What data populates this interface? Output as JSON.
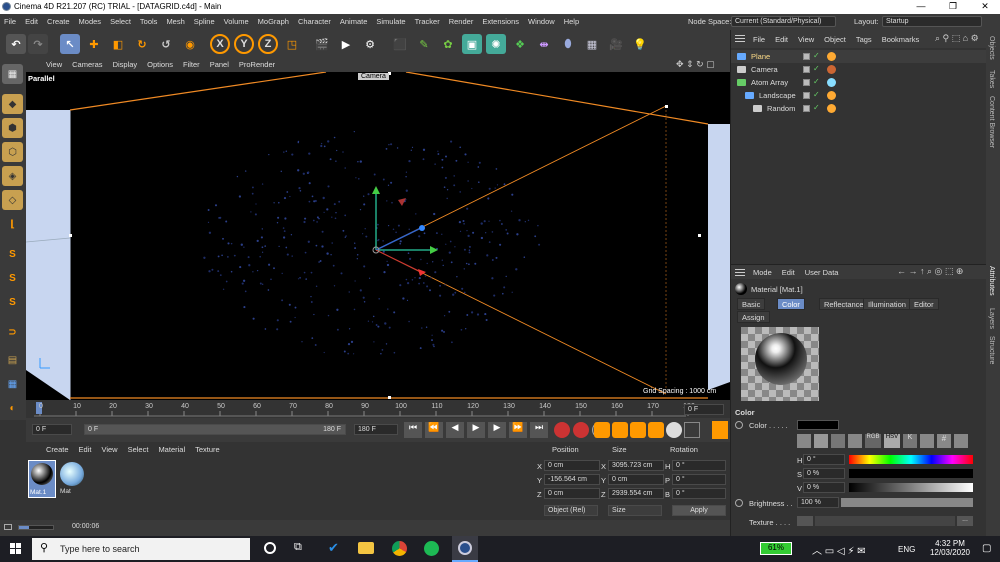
{
  "window": {
    "title": "Cinema 4D R21.207 (RC) TRIAL - [DATAGRID.c4d] - Main",
    "minimize": "—",
    "restore": "❐",
    "close": "✕"
  },
  "menu": [
    "File",
    "Edit",
    "Create",
    "Modes",
    "Select",
    "Tools",
    "Mesh",
    "Spline",
    "Volume",
    "MoGraph",
    "Character",
    "Animate",
    "Simulate",
    "Tracker",
    "Render",
    "Extensions",
    "Window",
    "Help"
  ],
  "nodespace": {
    "label": "Node Space:",
    "value": "Current (Standard/Physical)"
  },
  "layout": {
    "label": "Layout:",
    "value": "Startup"
  },
  "toolbar": {
    "axis_x": "X",
    "axis_y": "Y",
    "axis_z": "Z"
  },
  "viewport": {
    "menu": [
      "View",
      "Cameras",
      "Display",
      "Options",
      "Filter",
      "Panel",
      "ProRender"
    ],
    "projection": "Parallel",
    "camera_label": "Camera",
    "grid_spacing": "Grid Spacing : 1000 cm"
  },
  "timeline": {
    "ticks": [
      "0",
      "10",
      "20",
      "30",
      "40",
      "50",
      "60",
      "70",
      "80",
      "90",
      "100",
      "110",
      "120",
      "130",
      "140",
      "150",
      "160",
      "170",
      "180"
    ],
    "current_frame_field": "0 F",
    "start_field": "0 F",
    "range_start": "0 F",
    "range_end": "180 F",
    "end_field": "180 F"
  },
  "material_manager": {
    "menu": [
      "Create",
      "Edit",
      "View",
      "Select",
      "Material",
      "Texture"
    ],
    "materials": [
      {
        "name": "Mat.1",
        "type": "chrome"
      },
      {
        "name": "Mat",
        "type": "glow"
      }
    ]
  },
  "coords": {
    "headers": {
      "position": "Position",
      "size": "Size",
      "rotation": "Rotation"
    },
    "rows": [
      {
        "axis": "X",
        "pos": "0 cm",
        "size_axis": "X",
        "size": "3095.723 cm",
        "rot_axis": "H",
        "rot": "0 °"
      },
      {
        "axis": "Y",
        "pos": "-156.564 cm",
        "size_axis": "Y",
        "size": "0 cm",
        "rot_axis": "P",
        "rot": "0 °"
      },
      {
        "axis": "Z",
        "pos": "0 cm",
        "size_axis": "Z",
        "size": "2939.554 cm",
        "rot_axis": "B",
        "rot": "0 °"
      }
    ],
    "mode": "Object (Rel)",
    "size_mode": "Size",
    "apply": "Apply"
  },
  "status": {
    "time": "00:00:06"
  },
  "object_manager": {
    "menu": [
      "File",
      "Edit",
      "View",
      "Object",
      "Tags",
      "Bookmarks"
    ],
    "objects": [
      {
        "name": "Plane",
        "indent": 0,
        "selected": true
      },
      {
        "name": "Camera",
        "indent": 0,
        "selected": false
      },
      {
        "name": "Atom Array",
        "indent": 0,
        "selected": false
      },
      {
        "name": "Landscape",
        "indent": 1,
        "selected": false
      },
      {
        "name": "Random",
        "indent": 2,
        "selected": false
      }
    ]
  },
  "attributes": {
    "menu": [
      "Mode",
      "Edit",
      "User Data"
    ],
    "material_title": "Material [Mat.1]",
    "tabs": [
      "Basic",
      "Color",
      "Reflectance",
      "Illumination",
      "Editor"
    ],
    "active_tab": "Color",
    "assign_tab": "Assign",
    "section": "Color",
    "color_label": "Color . . . . .",
    "h": {
      "label": "H",
      "value": "0 °"
    },
    "s": {
      "label": "S",
      "value": "0 %"
    },
    "v": {
      "label": "V",
      "value": "0 %"
    },
    "brightness": {
      "label": "Brightness . .",
      "value": "100 %"
    },
    "texture_label": "Texture . . . ."
  },
  "right_tabs": [
    "Objects",
    "Takes",
    "Content Browser",
    "Attributes",
    "Layers",
    "Structure"
  ],
  "taskbar": {
    "search_placeholder": "Type here to search",
    "battery": "61%",
    "lang": "ENG",
    "time": "4:32 PM",
    "date": "12/03/2020"
  }
}
